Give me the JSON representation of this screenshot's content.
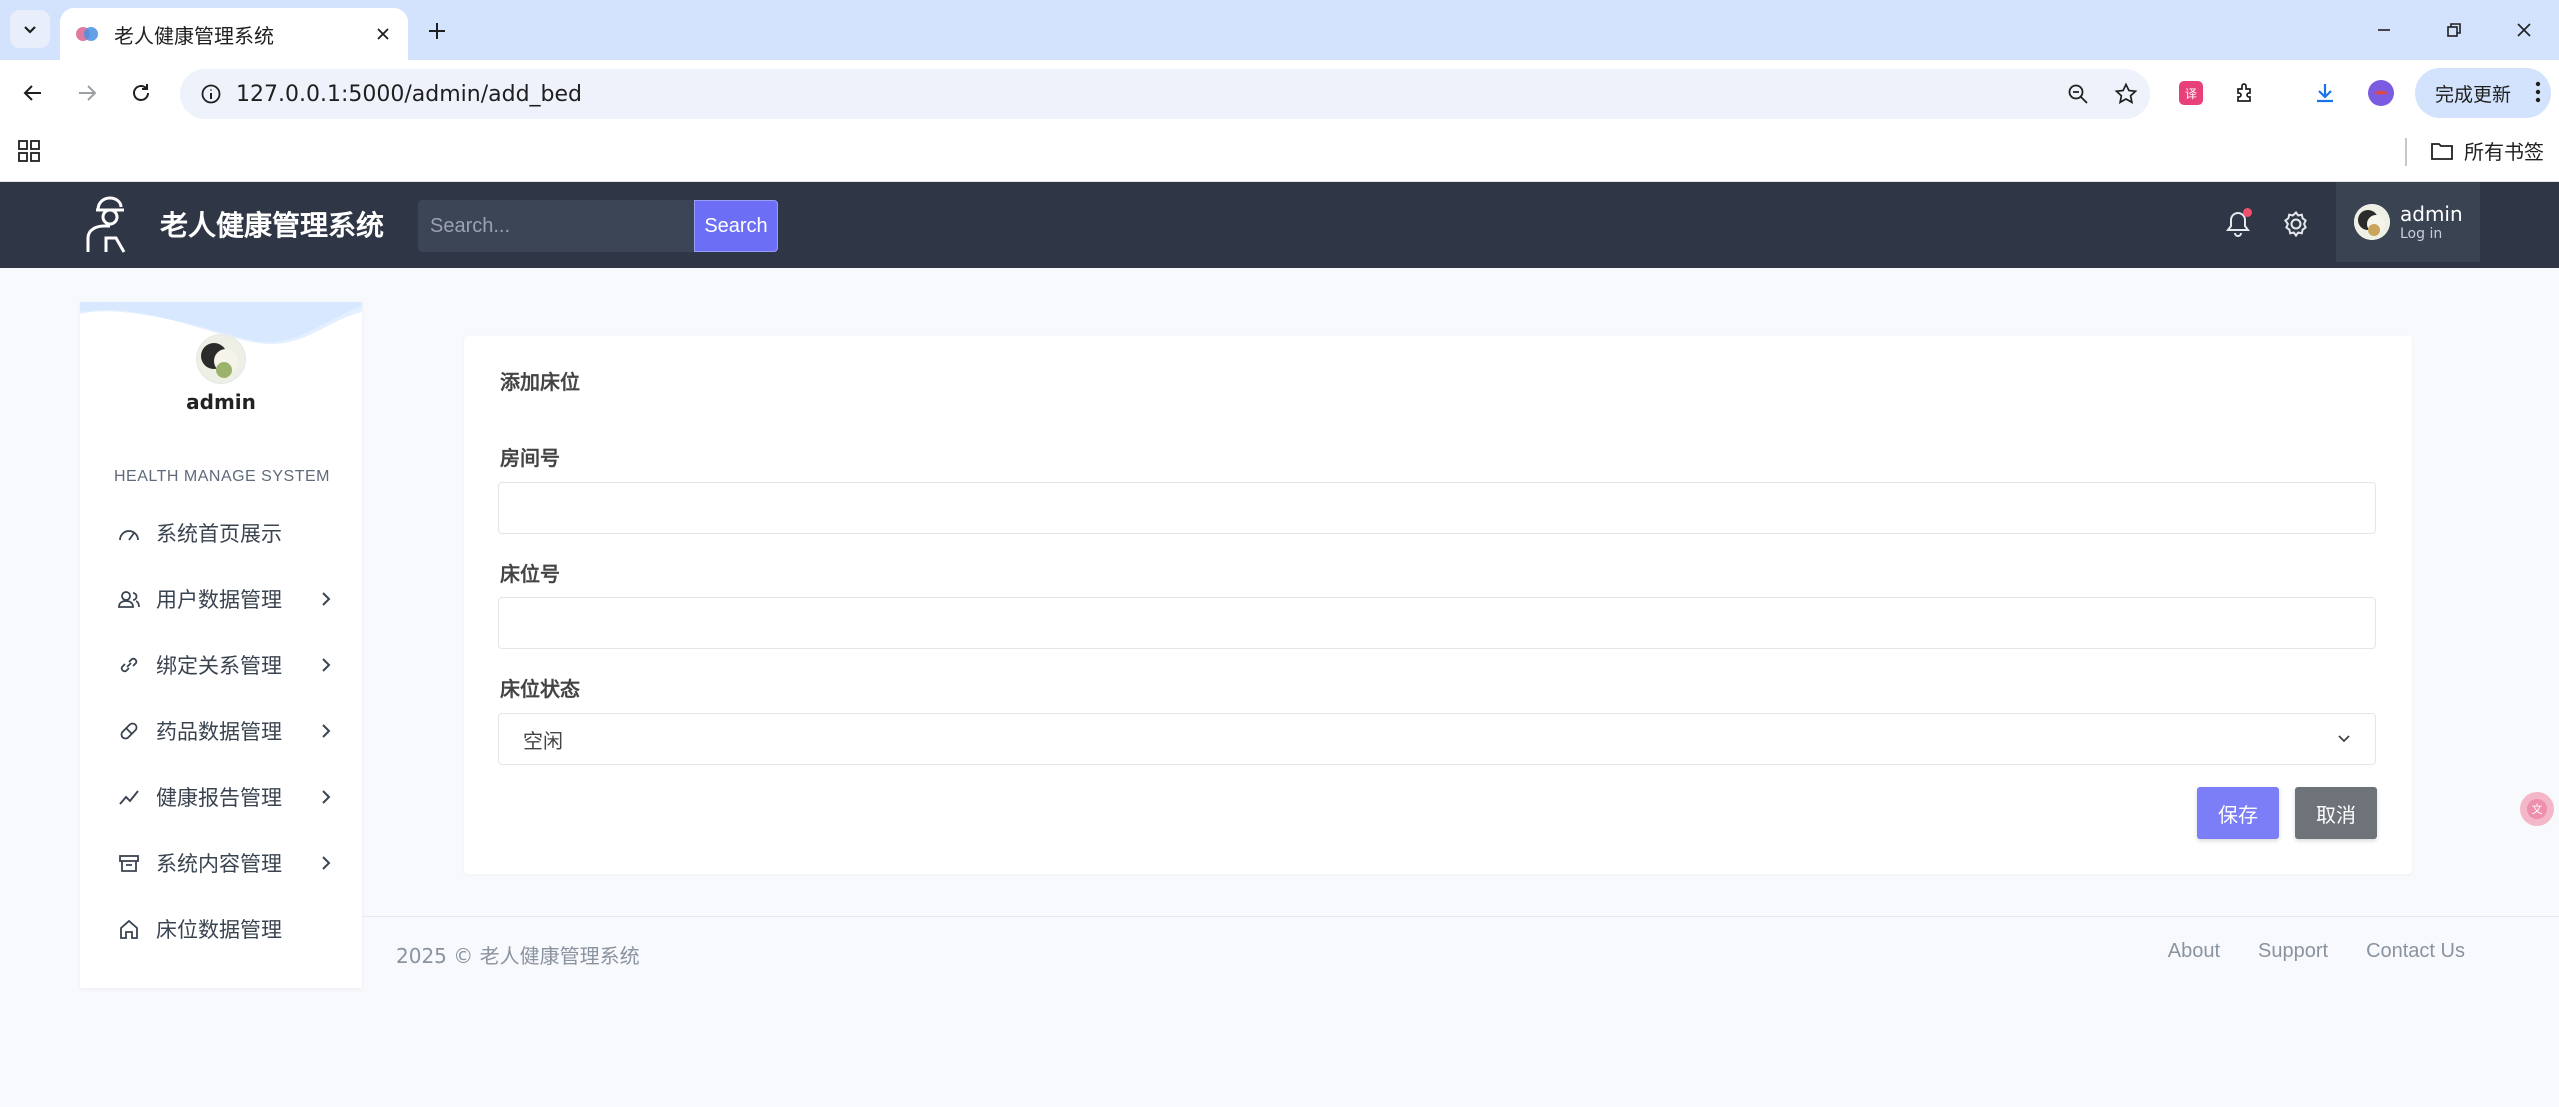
{
  "browser": {
    "tab_title": "老人健康管理系统",
    "url": "127.0.0.1:5000/admin/add_bed",
    "update_label": "完成更新",
    "bookmarks_folder": "所有书签"
  },
  "header": {
    "brand": "老人健康管理系统",
    "search_placeholder": "Search...",
    "search_button": "Search",
    "user_name": "admin",
    "user_status": "Log in"
  },
  "sidebar": {
    "user_name": "admin",
    "heading": "HEALTH MANAGE SYSTEM",
    "items": [
      {
        "label": "系统首页展示",
        "icon": "dashboard-icon",
        "has_arrow": false
      },
      {
        "label": "用户数据管理",
        "icon": "users-icon",
        "has_arrow": true
      },
      {
        "label": "绑定关系管理",
        "icon": "link-icon",
        "has_arrow": true
      },
      {
        "label": "药品数据管理",
        "icon": "pill-icon",
        "has_arrow": true
      },
      {
        "label": "健康报告管理",
        "icon": "chart-line-icon",
        "has_arrow": true
      },
      {
        "label": "系统内容管理",
        "icon": "archive-icon",
        "has_arrow": true
      },
      {
        "label": "床位数据管理",
        "icon": "home-icon",
        "has_arrow": false
      }
    ]
  },
  "form": {
    "title": "添加床位",
    "room_label": "房间号",
    "room_value": "",
    "bed_label": "床位号",
    "bed_value": "",
    "status_label": "床位状态",
    "status_value": "空闲",
    "save_label": "保存",
    "cancel_label": "取消"
  },
  "footer": {
    "copyright": "2025 © 老人健康管理系统",
    "links": [
      "About",
      "Support",
      "Contact Us"
    ]
  },
  "colors": {
    "header_bg": "#2f3746",
    "accent": "#6c6ff5",
    "cancel": "#6e7379",
    "page_bg": "#f8f9fc"
  }
}
